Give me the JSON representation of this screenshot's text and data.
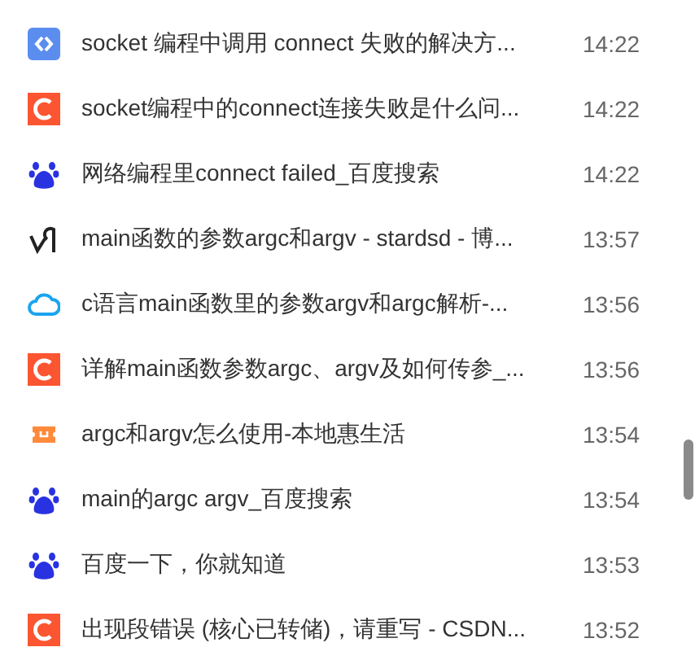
{
  "history": [
    {
      "kind": "code",
      "title": "socket 编程中调用 connect 失败的解决方...",
      "time": "14:22"
    },
    {
      "kind": "csdn",
      "title": "socket编程中的connect连接失败是什么问...",
      "time": "14:22"
    },
    {
      "kind": "baidu",
      "title": "网络编程里connect failed_百度搜索",
      "time": "14:22"
    },
    {
      "kind": "glyph",
      "title": "main函数的参数argc和argv - stardsd - 博...",
      "time": "13:57"
    },
    {
      "kind": "cloud",
      "title": "c语言main函数里的参数argv和argc解析-...",
      "time": "13:56"
    },
    {
      "kind": "csdn",
      "title": "详解main函数参数argc、argv及如何传参_...",
      "time": "13:56"
    },
    {
      "kind": "ticket",
      "title": "argc和argv怎么使用-本地惠生活",
      "time": "13:54"
    },
    {
      "kind": "baidu",
      "title": "main的argc argv_百度搜索",
      "time": "13:54"
    },
    {
      "kind": "baidu",
      "title": "百度一下，你就知道",
      "time": "13:53"
    },
    {
      "kind": "csdn",
      "title": "出现段错误 (核心已转储)，请重写 - CSDN...",
      "time": "13:52"
    }
  ]
}
